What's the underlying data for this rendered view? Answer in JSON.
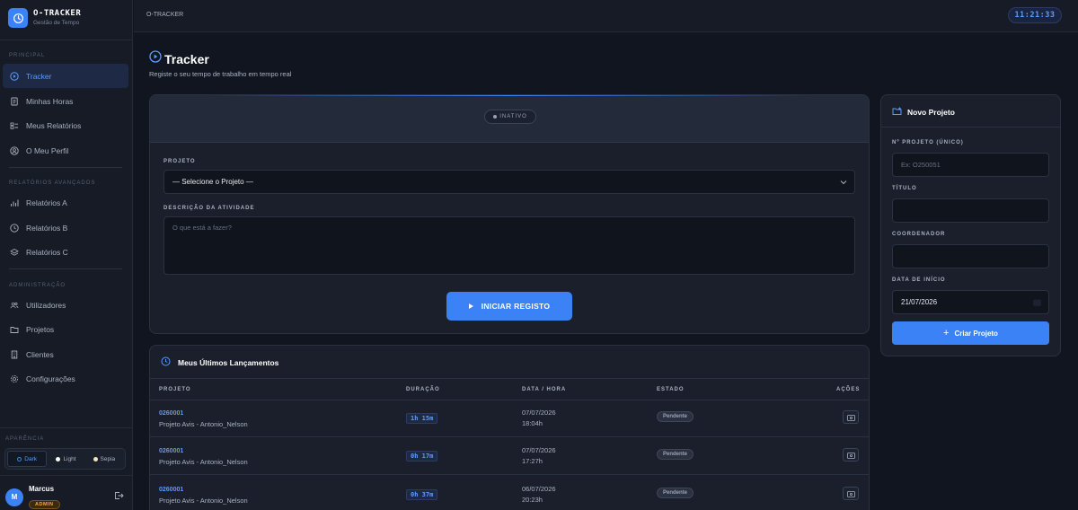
{
  "app": {
    "name": "O-TRACKER",
    "subtitle": "Gestão de Tempo"
  },
  "sidebar": {
    "sections": [
      {
        "label": "PRINCIPAL",
        "items": [
          {
            "label": "Tracker",
            "icon": "play-circle-icon",
            "active": true
          },
          {
            "label": "Minhas Horas",
            "icon": "document-icon"
          },
          {
            "label": "Meus Relatórios",
            "icon": "list-icon"
          },
          {
            "label": "O Meu Perfil",
            "icon": "user-icon"
          }
        ]
      },
      {
        "label": "RELATÓRIOS AVANÇADOS",
        "items": [
          {
            "label": "Relatórios A",
            "icon": "bar-chart-icon"
          },
          {
            "label": "Relatórios B",
            "icon": "clock-icon"
          },
          {
            "label": "Relatórios C",
            "icon": "layers-icon"
          }
        ]
      },
      {
        "label": "ADMINISTRAÇÃO",
        "items": [
          {
            "label": "Utilizadores",
            "icon": "users-icon"
          },
          {
            "label": "Projetos",
            "icon": "folder-icon"
          },
          {
            "label": "Clientes",
            "icon": "building-icon"
          },
          {
            "label": "Configurações",
            "icon": "gear-icon"
          }
        ]
      }
    ],
    "appearance": {
      "label": "APARÊNCIA",
      "options": [
        {
          "label": "Dark",
          "active": true
        },
        {
          "label": "Light"
        },
        {
          "label": "Sepia"
        }
      ]
    },
    "user": {
      "initial": "M",
      "name": "Marcus",
      "role": "ADMIN"
    }
  },
  "topbar": {
    "breadcrumb": "O-TRACKER",
    "clock": "11:21:33"
  },
  "page": {
    "title": "Tracker",
    "subtitle": "Registe o seu tempo de trabalho em tempo real"
  },
  "tracker": {
    "status": "INATIVO",
    "project_label": "PROJETO",
    "project_value": "— Selecione o Projeto —",
    "description_label": "DESCRIÇÃO DA ATIVIDADE",
    "description_placeholder": "O que está a fazer?",
    "start_button": "INICIAR REGISTO"
  },
  "entries": {
    "title": "Meus Últimos Lançamentos",
    "columns": [
      "PROJETO",
      "DURAÇÃO",
      "DATA / HORA",
      "ESTADO",
      "AÇÕES"
    ],
    "rows": [
      {
        "code": "0260001",
        "name": "Projeto Avis - Antonio_Nelson",
        "duration": "1h 15m",
        "date": "07/07/2026",
        "time": "18:04h",
        "status": "Pendente"
      },
      {
        "code": "0260001",
        "name": "Projeto Avis - Antonio_Nelson",
        "duration": "0h 17m",
        "date": "07/07/2026",
        "time": "17:27h",
        "status": "Pendente"
      },
      {
        "code": "0260001",
        "name": "Projeto Avis - Antonio_Nelson",
        "duration": "0h 37m",
        "date": "06/07/2026",
        "time": "20:23h",
        "status": "Pendente"
      }
    ]
  },
  "new_project": {
    "title": "Novo Projeto",
    "number_label": "Nº PROJETO (ÚNICO)",
    "number_placeholder": "Ex: O250051",
    "title_label": "TÍTULO",
    "title_value": "",
    "coordinator_label": "COORDENADOR",
    "coordinator_value": "",
    "start_date_label": "DATA DE INÍCIO",
    "start_date_value": "21/07/2026",
    "create_button": "Criar Projeto"
  },
  "colors": {
    "accent": "#3b82f6",
    "background": "#111520",
    "sidebar": "#161b26",
    "admin_badge": "#f2a93b"
  }
}
